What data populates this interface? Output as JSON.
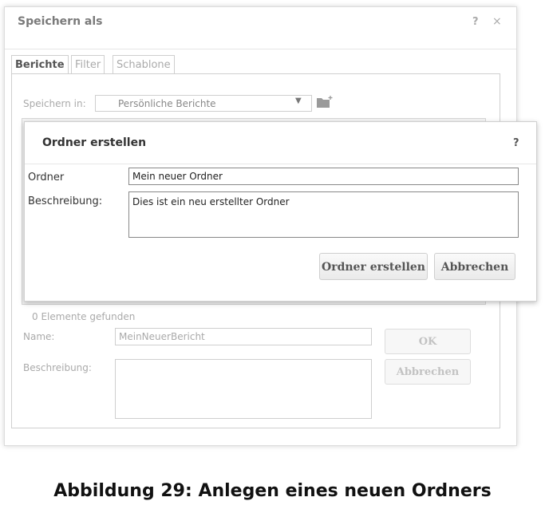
{
  "outer_dialog": {
    "title": "Speichern als",
    "help": "?",
    "close": "×",
    "tabs": [
      {
        "label": "Berichte",
        "active": true
      },
      {
        "label": "Filter",
        "active": false
      },
      {
        "label": "Schablone",
        "active": false
      }
    ],
    "save_in_label": "Speichern in:",
    "save_in_value": "Persönliche Berichte",
    "found_count": "0 Elemente gefunden",
    "name_label": "Name:",
    "name_value": "MeinNeuerBericht",
    "description_label": "Beschreibung:",
    "ok_button": "OK",
    "cancel_button": "Abbrechen"
  },
  "inner_dialog": {
    "title": "Ordner erstellen",
    "help": "?",
    "folder_label": "Ordner",
    "folder_value": "Mein neuer Ordner",
    "description_label": "Beschreibung:",
    "description_value": "Dies ist ein neu erstellter Ordner",
    "create_button": "Ordner erstellen",
    "cancel_button": "Abbrechen"
  },
  "caption": "Abbildung 29: Anlegen eines neuen Ordners"
}
